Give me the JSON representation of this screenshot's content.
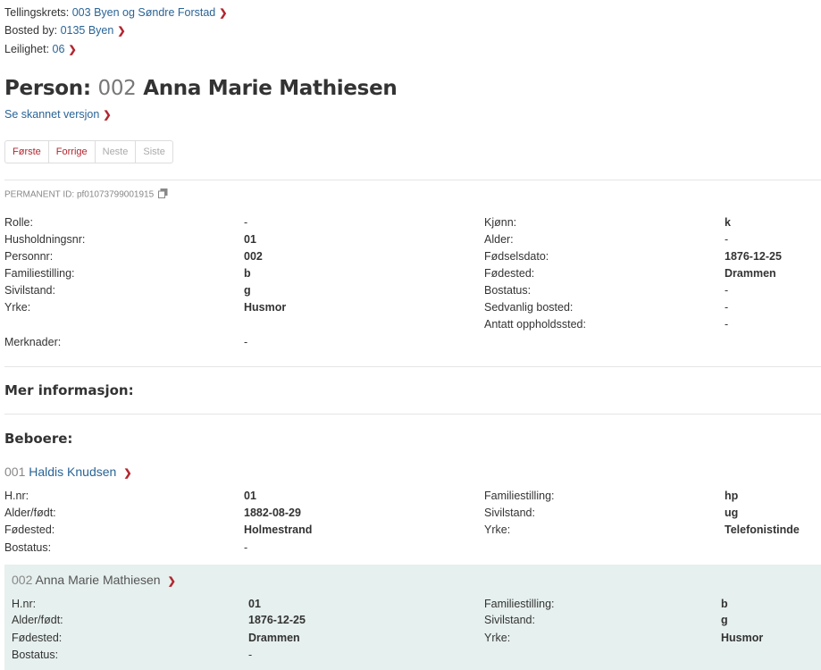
{
  "breadcrumbs": [
    {
      "label": "Tellingskrets:",
      "value": "003 Byen og Søndre Forstad"
    },
    {
      "label": "Bosted by:",
      "value": "0135 Byen"
    },
    {
      "label": "Leilighet:",
      "value": "06"
    }
  ],
  "title": {
    "prefix": "Person:",
    "number": "002",
    "name": "Anna Marie Mathiesen"
  },
  "scan_link": "Se skannet versjon",
  "pager": [
    "Første",
    "Forrige",
    "Neste",
    "Siste"
  ],
  "permanent_id": "PERMANENT ID: pf01073799001915",
  "details_left": [
    {
      "label": "Rolle:",
      "value": "-"
    },
    {
      "label": "Husholdningsnr:",
      "value": "01"
    },
    {
      "label": "Personnr:",
      "value": "002"
    },
    {
      "label": "Familiestilling:",
      "value": "b"
    },
    {
      "label": "Sivilstand:",
      "value": "g"
    },
    {
      "label": "Yrke:",
      "value": "Husmor"
    }
  ],
  "details_right": [
    {
      "label": "Kjønn:",
      "value": "k"
    },
    {
      "label": "Alder:",
      "value": "-"
    },
    {
      "label": "Fødselsdato:",
      "value": "1876-12-25"
    },
    {
      "label": "Fødested:",
      "value": "Drammen"
    },
    {
      "label": "Bostatus:",
      "value": "-"
    },
    {
      "label": "Sedvanlig bosted:",
      "value": "-"
    },
    {
      "label": "Antatt oppholdssted:",
      "value": "-"
    }
  ],
  "merknader": {
    "label": "Merknader:",
    "value": "-"
  },
  "more_info_heading": "Mer informasjon:",
  "residents_heading": "Beboere:",
  "residents": [
    {
      "num": "001",
      "name": "Haldis Knudsen",
      "left": [
        {
          "label": "H.nr:",
          "value": "01"
        },
        {
          "label": "Alder/født:",
          "value": "1882-08-29"
        },
        {
          "label": "Fødested:",
          "value": "Holmestrand"
        },
        {
          "label": "Bostatus:",
          "value": "-"
        }
      ],
      "right": [
        {
          "label": "Familiestilling:",
          "value": "hp"
        },
        {
          "label": "Sivilstand:",
          "value": "ug"
        },
        {
          "label": "Yrke:",
          "value": "Telefonistinde"
        }
      ]
    },
    {
      "num": "002",
      "name": "Anna Marie Mathiesen",
      "left": [
        {
          "label": "H.nr:",
          "value": "01"
        },
        {
          "label": "Alder/født:",
          "value": "1876-12-25"
        },
        {
          "label": "Fødested:",
          "value": "Drammen"
        },
        {
          "label": "Bostatus:",
          "value": "-"
        }
      ],
      "right": [
        {
          "label": "Familiestilling:",
          "value": "b"
        },
        {
          "label": "Sivilstand:",
          "value": "g"
        },
        {
          "label": "Yrke:",
          "value": "Husmor"
        }
      ]
    }
  ]
}
